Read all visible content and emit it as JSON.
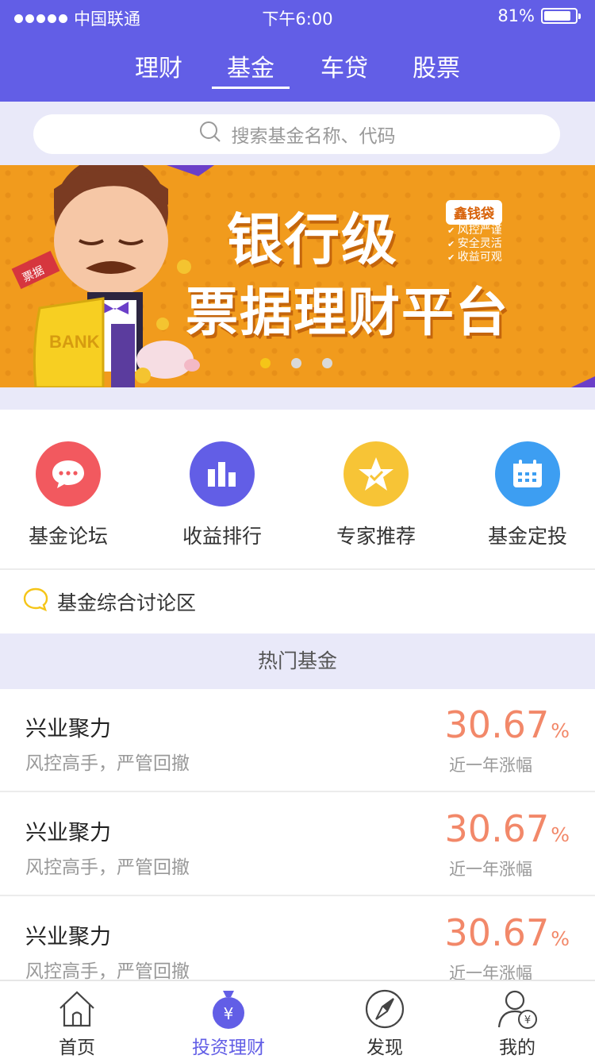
{
  "status": {
    "carrier": "中国联通",
    "time": "下午6:00",
    "battery": "81%"
  },
  "tabs": [
    {
      "label": "理财"
    },
    {
      "label": "基金",
      "active": true
    },
    {
      "label": "车贷"
    },
    {
      "label": "股票"
    }
  ],
  "search": {
    "placeholder": "搜索基金名称、代码"
  },
  "banner": {
    "headline": "银行级",
    "subheadline": "票据理财平台",
    "brand": "鑫钱袋",
    "features": [
      "风控严谨",
      "安全灵活",
      "收益可观"
    ],
    "pages": 3,
    "current_page": 1
  },
  "quick_links": [
    {
      "label": "基金论坛",
      "icon": "chat-bubble-icon",
      "color": "#f2595f"
    },
    {
      "label": "收益排行",
      "icon": "bar-chart-icon",
      "color": "#625ee6"
    },
    {
      "label": "专家推荐",
      "icon": "star-badge-icon",
      "color": "#f7c436"
    },
    {
      "label": "基金定投",
      "icon": "calendar-icon",
      "color": "#3d9ef2"
    }
  ],
  "forum": {
    "label": "基金综合讨论区"
  },
  "hot_funds": {
    "title": "热门基金",
    "items": [
      {
        "name": "兴业聚力",
        "desc": "风控高手，严管回撤",
        "rate": "30.67",
        "unit": "%",
        "rate_label": "近一年涨幅"
      },
      {
        "name": "兴业聚力",
        "desc": "风控高手，严管回撤",
        "rate": "30.67",
        "unit": "%",
        "rate_label": "近一年涨幅"
      },
      {
        "name": "兴业聚力",
        "desc": "风控高手，严管回撤",
        "rate": "30.67",
        "unit": "%",
        "rate_label": "近一年涨幅"
      }
    ]
  },
  "tabbar": [
    {
      "label": "首页",
      "icon": "home-icon"
    },
    {
      "label": "投资理财",
      "icon": "money-bag-icon",
      "active": true
    },
    {
      "label": "发现",
      "icon": "compass-icon"
    },
    {
      "label": "我的",
      "icon": "user-icon"
    }
  ],
  "colors": {
    "primary": "#625ee6",
    "rate": "#f28869",
    "page_bg": "#e9e9f9"
  }
}
